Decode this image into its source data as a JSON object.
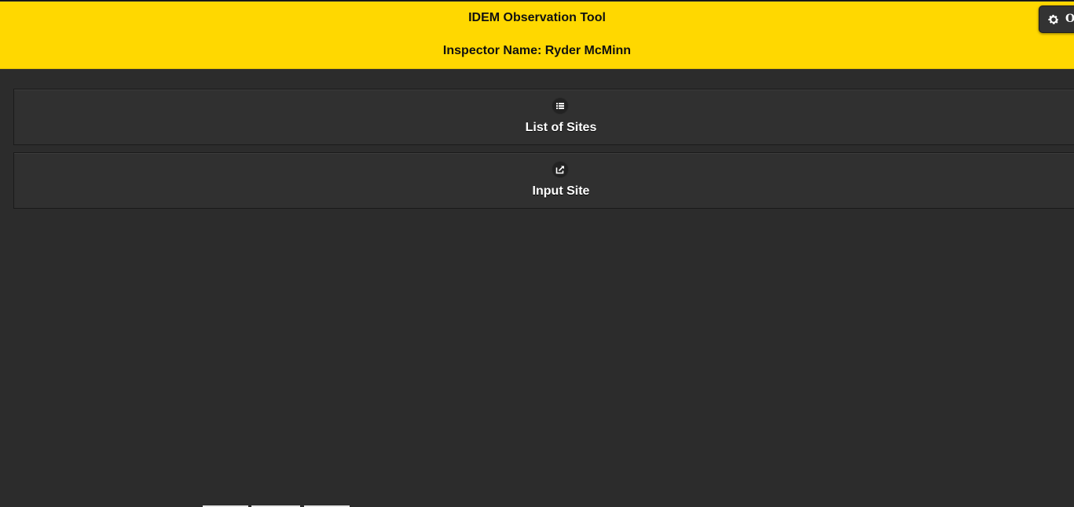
{
  "header": {
    "title": "IDEM Observation Tool",
    "inspector": "Inspector Name: Ryder McMinn",
    "background_color": "#ffd800"
  },
  "settings_button": {
    "icon": "gear-icon",
    "label": "O"
  },
  "nav": {
    "items": [
      {
        "label": "List of Sites",
        "icon": "list-icon"
      },
      {
        "label": "Input Site",
        "icon": "export-icon"
      }
    ]
  }
}
